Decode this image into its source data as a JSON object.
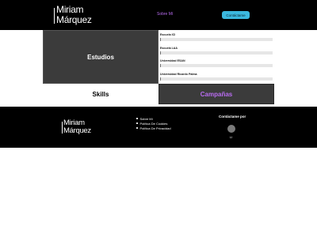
{
  "header": {
    "logo_line1": "Miriam",
    "logo_line2": "Márquez",
    "nav_link": "Sobre Mí",
    "cta_label": "Contáctame"
  },
  "main": {
    "estudios_title": "Estudios",
    "skills_title": "Skills",
    "campanas_title": "Campañas",
    "skills": [
      {
        "label": "Escuela ICI"
      },
      {
        "label": "Escuela LAA"
      },
      {
        "label": "Universidad ESAN"
      },
      {
        "label": "Universidad Ricardo Palma"
      }
    ]
  },
  "footer": {
    "logo_line1": "Miriam",
    "logo_line2": "Márquez",
    "links": [
      "Sobre Mí",
      "Política De Cookies",
      "Política De Privacidad"
    ],
    "contact_title": "Contáctame por",
    "social_label": "LI"
  },
  "colors": {
    "accent_purple": "#b86cf0",
    "cta_blue": "#3bb8de",
    "dark_panel": "#3b3b3b"
  }
}
